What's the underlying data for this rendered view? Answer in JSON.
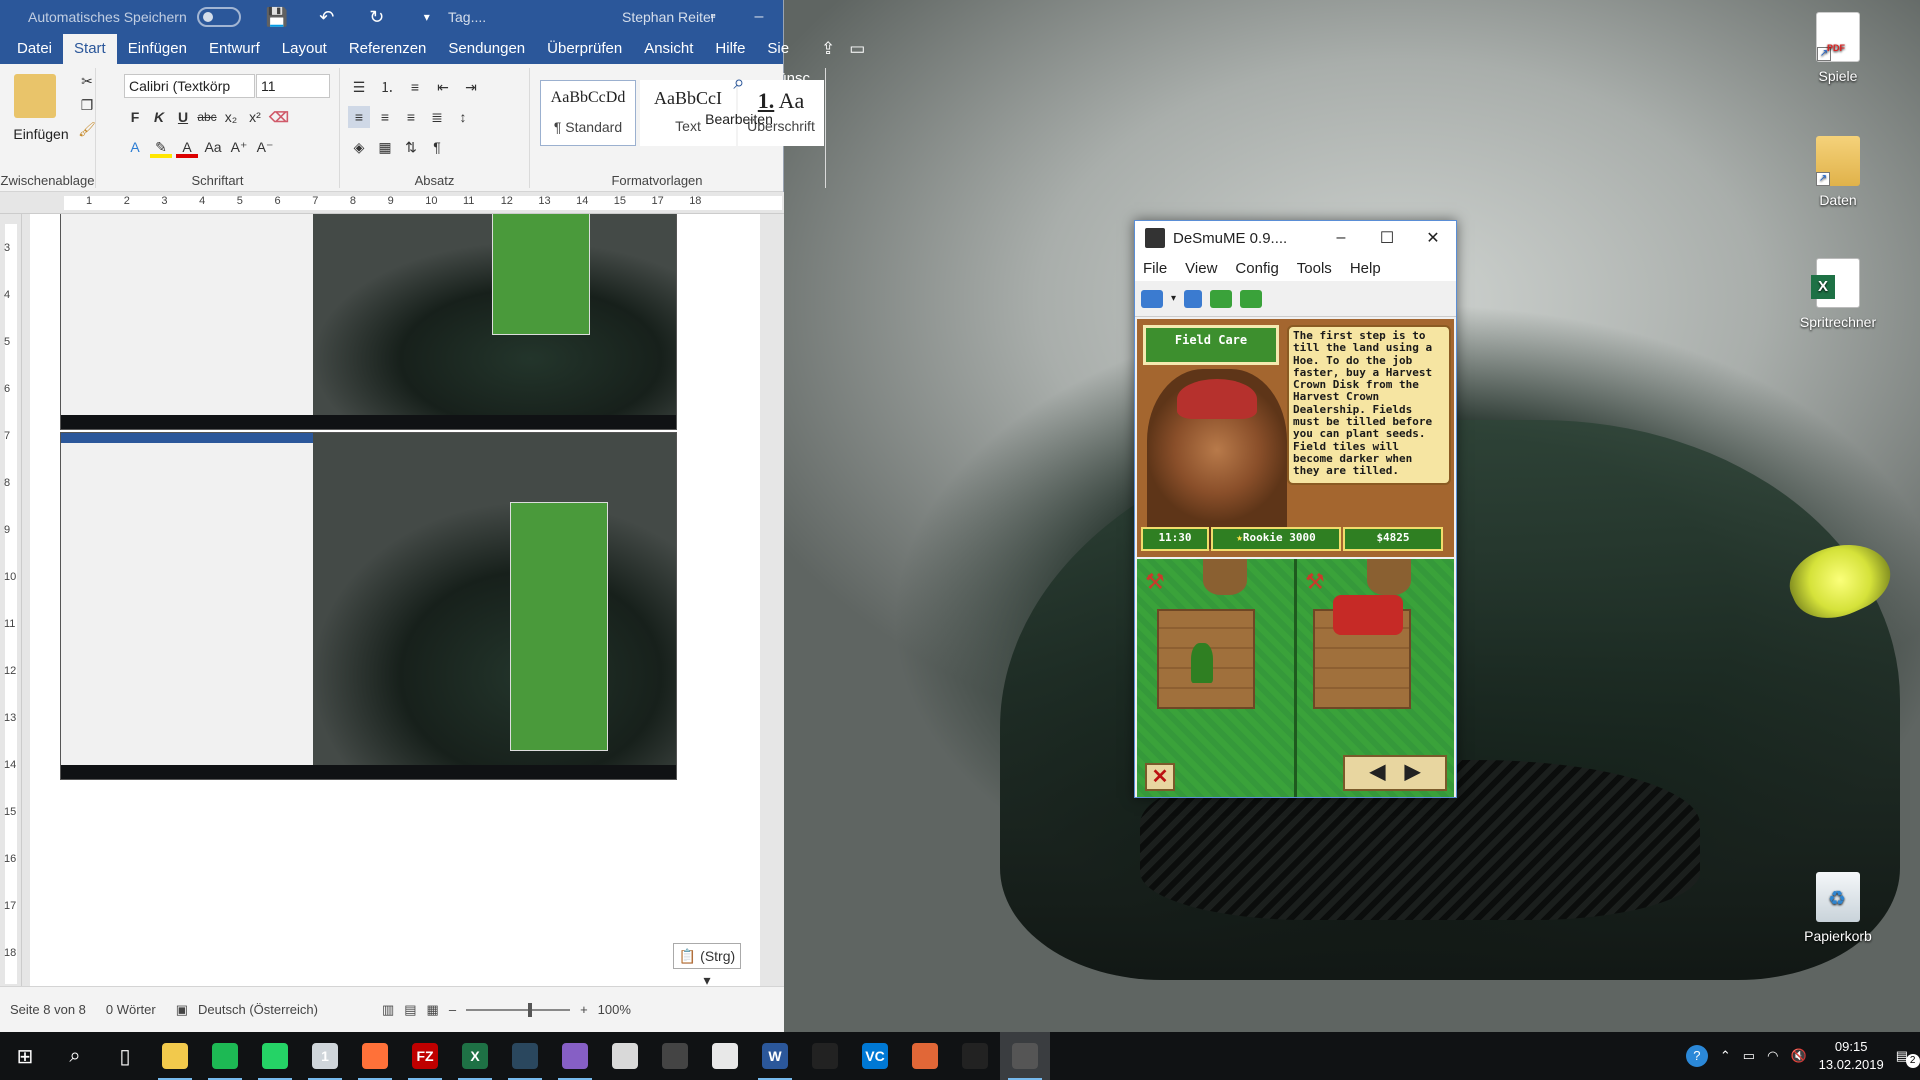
{
  "desktop": {
    "icons": [
      {
        "label": "Spiele",
        "glyph": "pdf-file-icon"
      },
      {
        "label": "Daten",
        "glyph": "folder-icon"
      },
      {
        "label": "Spritrechner",
        "glyph": "excel-file-icon"
      },
      {
        "label": "Papierkorb",
        "glyph": "recycle-bin-icon"
      }
    ]
  },
  "word": {
    "autosave_label": "Automatisches Speichern",
    "doc_title": "Tag....",
    "user": "Stephan Reiter",
    "tabs": [
      "Datei",
      "Start",
      "Einfügen",
      "Entwurf",
      "Layout",
      "Referenzen",
      "Sendungen",
      "Überprüfen",
      "Ansicht",
      "Hilfe",
      "Sie wünsc"
    ],
    "active_tab": "Start",
    "ribbon": {
      "paste_label": "Einfügen",
      "clipboard_group": "Zwischenablage",
      "font_group": "Schriftart",
      "paragraph_group": "Absatz",
      "styles_group": "Formatvorlagen",
      "edit_label": "Bearbeiten",
      "font_name": "Calibri (Textkörp",
      "font_size": "11",
      "bold": "F",
      "italic": "K",
      "underline": "U",
      "strike": "abc",
      "subscript": "x₂",
      "superscript": "x²",
      "styles": [
        {
          "sample": "AaBbCcDd",
          "name": "¶ Standard"
        },
        {
          "sample": "AaBbCcI",
          "name": "Text"
        },
        {
          "sample": "1.",
          "sample2": "Aa",
          "name": "Überschrift"
        }
      ]
    },
    "ruler_numbers": [
      "1",
      "2",
      "3",
      "4",
      "5",
      "6",
      "7",
      "8",
      "9",
      "10",
      "11",
      "12",
      "13",
      "14",
      "15",
      "17",
      "18"
    ],
    "vruler_numbers": [
      "3",
      "4",
      "5",
      "6",
      "7",
      "8",
      "9",
      "10",
      "11",
      "12",
      "13",
      "14",
      "15",
      "16",
      "17",
      "18"
    ],
    "paste_options": "(Strg)",
    "status": {
      "page": "Seite 8 von 8",
      "words": "0 Wörter",
      "language": "Deutsch (Österreich)",
      "zoom": "100%"
    }
  },
  "desmume": {
    "title": "DeSmuME 0.9....",
    "menu": [
      "File",
      "View",
      "Config",
      "Tools",
      "Help"
    ],
    "top_screen": {
      "label": "Field Care",
      "speech": "The first step is to till the land using a Hoe. To do the job faster, buy a Harvest Crown Disk from the Harvest Crown Dealership. Fields must be tilled before you can plant seeds. Field tiles will become darker when they are tilled.",
      "time": "11:30",
      "rank": "Rookie 3000",
      "money": "$4825"
    }
  },
  "taskbar": {
    "apps": [
      {
        "name": "file-explorer-icon",
        "color": "#f2c94c",
        "glyph": ""
      },
      {
        "name": "spotify-icon",
        "color": "#1db954",
        "glyph": ""
      },
      {
        "name": "whatsapp-icon",
        "color": "#25d366",
        "glyph": ""
      },
      {
        "name": "mail-icon",
        "color": "#cfd5da",
        "glyph": "1"
      },
      {
        "name": "firefox-icon",
        "color": "#ff7139",
        "glyph": ""
      },
      {
        "name": "filezilla-icon",
        "color": "#bf0000",
        "glyph": "FZ"
      },
      {
        "name": "excel-icon",
        "color": "#1e7145",
        "glyph": "X"
      },
      {
        "name": "steam-icon",
        "color": "#2a475e",
        "glyph": ""
      },
      {
        "name": "visual-studio-icon",
        "color": "#865fc5",
        "glyph": ""
      },
      {
        "name": "paint-icon",
        "color": "#d9d9d9",
        "glyph": ""
      },
      {
        "name": "inkscape-icon",
        "color": "#444",
        "glyph": ""
      },
      {
        "name": "calculator-icon",
        "color": "#e8e8e8",
        "glyph": ""
      },
      {
        "name": "word-icon",
        "color": "#2b579a",
        "glyph": "W"
      },
      {
        "name": "inkscape-dark-icon",
        "color": "#222",
        "glyph": ""
      },
      {
        "name": "vs-code-icon",
        "color": "#0078d4",
        "glyph": "VC"
      },
      {
        "name": "matlab-icon",
        "color": "#e16737",
        "glyph": ""
      },
      {
        "name": "unity-icon",
        "color": "#222",
        "glyph": ""
      },
      {
        "name": "desmume-icon",
        "color": "#555",
        "glyph": ""
      }
    ],
    "clock_time": "09:15",
    "clock_date": "13.02.2019",
    "notification_count": "2"
  }
}
